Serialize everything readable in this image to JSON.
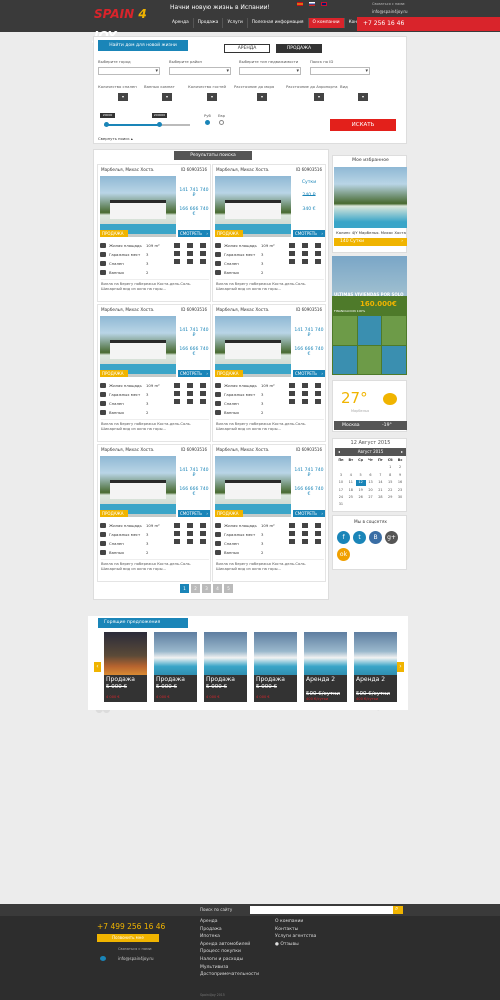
{
  "header": {
    "logo_text": "SPAIN 4 JOY",
    "slogan": "Начни новую жизнь в Испании!",
    "nav": [
      "Аренда",
      "Продажа",
      "Услуги",
      "Полезная информация",
      "О компании",
      "Контакты"
    ],
    "contact_label": "Связаться с нами:",
    "email": "info@spain4joy.ru",
    "phone": "+7    256 16 46"
  },
  "search": {
    "title": "Найти дом для новой жизни",
    "tab_rent": "АРЕНДА",
    "tab_sale": "ПРОДАЖА",
    "labels": {
      "city": "Выберите город",
      "district": "Выберите район",
      "type": "Выберите тип недвижимости",
      "id_search": "Поиск по ID",
      "bedrooms": "Количество спален",
      "bathrooms": "Ванных комнат",
      "guests": "Количество гостей",
      "sea": "Расстояние до моря",
      "airport": "Расстояние до Аэропорта",
      "view": "Вид"
    },
    "slider_min": "20000",
    "slider_max": "200000",
    "currency_1": "Руб",
    "currency_2": "Евр",
    "collapse": "Свернуть поиск",
    "button": "ИСКАТЬ"
  },
  "results": {
    "title": "Результаты поиска",
    "cards": [
      {
        "location": "Марбелья, Михас Хоста.",
        "id": "ID 60903516",
        "price1": "141 741 740 ₽",
        "price2": "166 666 740 €",
        "badge": "ПРОДАЖА",
        "more": "СМОТРЕТЬ"
      },
      {
        "location": "Марбелья, Михас Хоста.",
        "id": "ID 60903516",
        "price1": "Сутки",
        "price2": "340 €",
        "price1_old": "240 ₽",
        "badge": "ПРОДАЖА",
        "more": "СМОТРЕТЬ"
      },
      {
        "location": "Марбелья, Михас Хоста.",
        "id": "ID 60903516",
        "price1": "141 741 740 ₽",
        "price2": "166 666 740 €",
        "badge": "ПРОДАЖА",
        "more": "СМОТРЕТЬ"
      },
      {
        "location": "Марбелья, Михас Хоста.",
        "id": "ID 60903516",
        "price1": "141 741 740 ₽",
        "price2": "166 666 740 €",
        "badge": "ПРОДАЖА",
        "more": "СМОТРЕТЬ"
      },
      {
        "location": "Марбелья, Михас Хоста.",
        "id": "ID 60903516",
        "price1": "141 741 740 ₽",
        "price2": "166 666 740 €",
        "badge": "ПРОДАЖА",
        "more": "СМОТРЕТЬ"
      },
      {
        "location": "Марбелья, Михас Хоста.",
        "id": "ID 60903516",
        "price1": "141 741 740 ₽",
        "price2": "166 666 740 €",
        "badge": "ПРОДАЖА",
        "more": "СМОТРЕТЬ"
      }
    ],
    "spec_labels": [
      "Жилая площадь",
      "Гаражных мест",
      "Спален",
      "Ванных"
    ],
    "spec_values": [
      "109 m²",
      "3",
      "3",
      "2"
    ],
    "description": "Вилла на берегу побережья Коста-дель-Соль. Шикарный вид из окна на горы..."
  },
  "pagination": [
    "1",
    "2",
    "3",
    "4",
    "5"
  ],
  "favorites": {
    "title": "Мое избранное",
    "name": "Калипс 4JY Марбелья. Михас Хоста",
    "price": "140 Сутки"
  },
  "ad": {
    "title": "ULTIMAS VIVIENDAS POR SOLO",
    "price": "160.000€",
    "caption": "FINANCIACION 100%"
  },
  "weather": {
    "temp": "27°",
    "city": "Марбелья",
    "moscow": "Москва",
    "moscow_temp": "-19°"
  },
  "calendar": {
    "title": "12 Август 2015",
    "month": "Август 2015",
    "days": [
      "Пн",
      "Вт",
      "Ср",
      "Чт",
      "Пт",
      "Сб",
      "Вс"
    ],
    "dates": [
      "",
      "",
      "",
      "",
      "",
      "1",
      "2",
      "3",
      "4",
      "5",
      "6",
      "7",
      "8",
      "9",
      "10",
      "11",
      "12",
      "13",
      "14",
      "15",
      "16",
      "17",
      "18",
      "19",
      "20",
      "21",
      "22",
      "23",
      "24",
      "25",
      "26",
      "27",
      "28",
      "29",
      "30",
      "31"
    ],
    "today": "12"
  },
  "social": {
    "title": "Мы в соцсетях",
    "icons": [
      "f",
      "t",
      "B",
      "g+",
      "ok"
    ]
  },
  "offers": {
    "title": "Горящие предложения",
    "items": [
      {
        "type": "Продажа",
        "price": "5 000 €",
        "new_price": "4 000 €"
      },
      {
        "type": "Продажа",
        "price": "5 000 €",
        "new_price": "4 000 €"
      },
      {
        "type": "Продажа",
        "price": "5 000 €",
        "new_price": "4 000 €"
      },
      {
        "type": "Продажа",
        "price": "5 000 €",
        "new_price": "4 000 €"
      },
      {
        "type": "Аренда 2",
        "price": "500 €/сутки",
        "new_price": "400 €/сутки"
      },
      {
        "type": "Аренда 2",
        "price": "500 €/сутки",
        "new_price": "400 €/сутки"
      }
    ]
  },
  "footer": {
    "search_label": "Поиск по сайту",
    "phone": "+7 499 256 16 46",
    "callback": "Позвонить мне",
    "contact_label": "Связаться с нами:",
    "email": "info@spain4joy.ru",
    "col1": [
      "Аренда",
      "Продажа",
      "Ипотека",
      "Аренда автомобилей",
      "Процесс покупки",
      "Налоги и расходы",
      "Мультивиза",
      "Достопримечательности"
    ],
    "col2": [
      "О компании",
      "Контакты",
      "Услуги агентства",
      "Отзывы"
    ],
    "copyright": "Spain4Joy 2015"
  },
  "colors": {
    "accent": "#1a85b8",
    "brand_red": "#d9242b",
    "yellow": "#f0b400",
    "dark": "#3a3a3a"
  }
}
